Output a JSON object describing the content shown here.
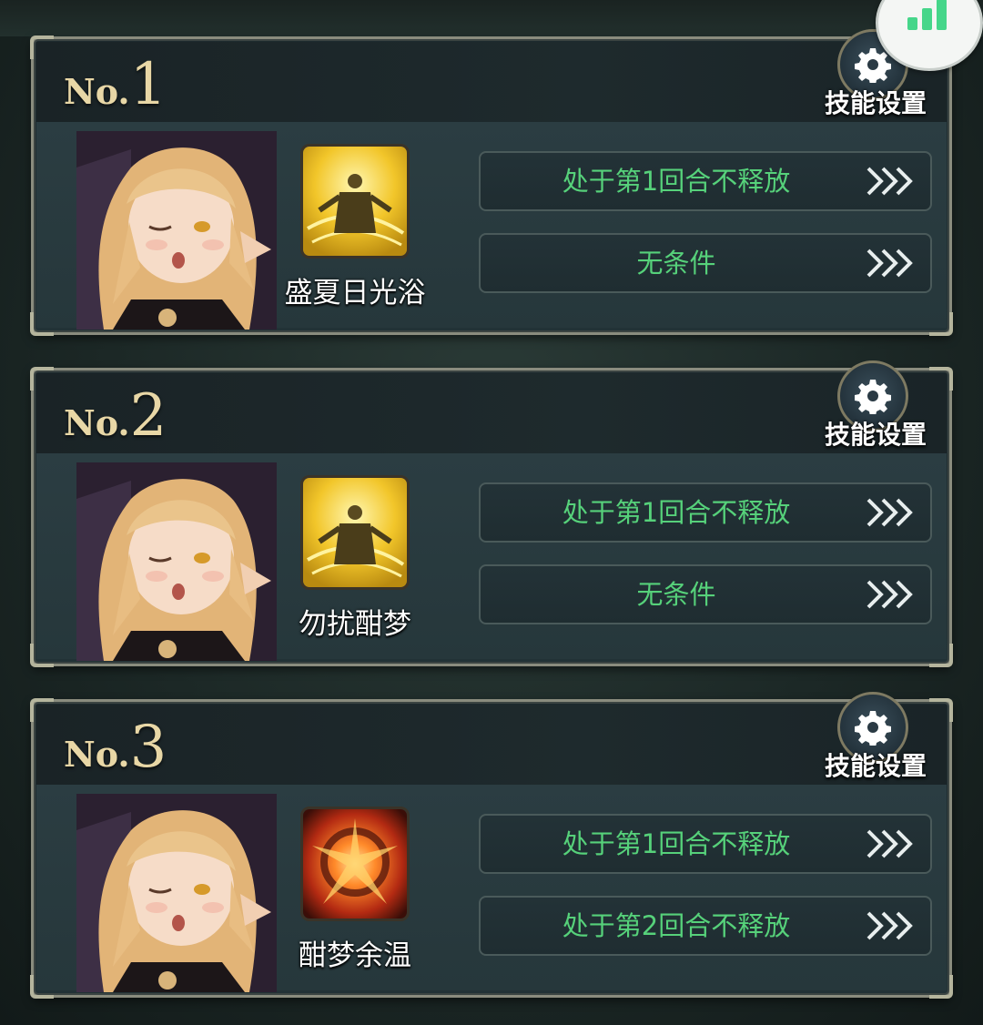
{
  "colors": {
    "condition_text": "#56d17a",
    "number_gold": "#e8d7a6",
    "frame": "#8a8c7e"
  },
  "status_badge": {
    "icon": "signal-bars-icon"
  },
  "slots": [
    {
      "no_prefix": "No.",
      "number": "1",
      "settings_label": "技能设置",
      "skill_name": "盛夏日光浴",
      "skill_icon": "golden-light-skill-icon",
      "conditions": [
        "处于第1回合不释放",
        "无条件"
      ]
    },
    {
      "no_prefix": "No.",
      "number": "2",
      "settings_label": "技能设置",
      "skill_name": "勿扰酣梦",
      "skill_icon": "golden-light-skill-icon",
      "conditions": [
        "处于第1回合不释放",
        "无条件"
      ]
    },
    {
      "no_prefix": "No.",
      "number": "3",
      "settings_label": "技能设置",
      "skill_name": "酣梦余温",
      "skill_icon": "fire-burst-skill-icon",
      "conditions": [
        "处于第1回合不释放",
        "处于第2回合不释放"
      ]
    }
  ]
}
